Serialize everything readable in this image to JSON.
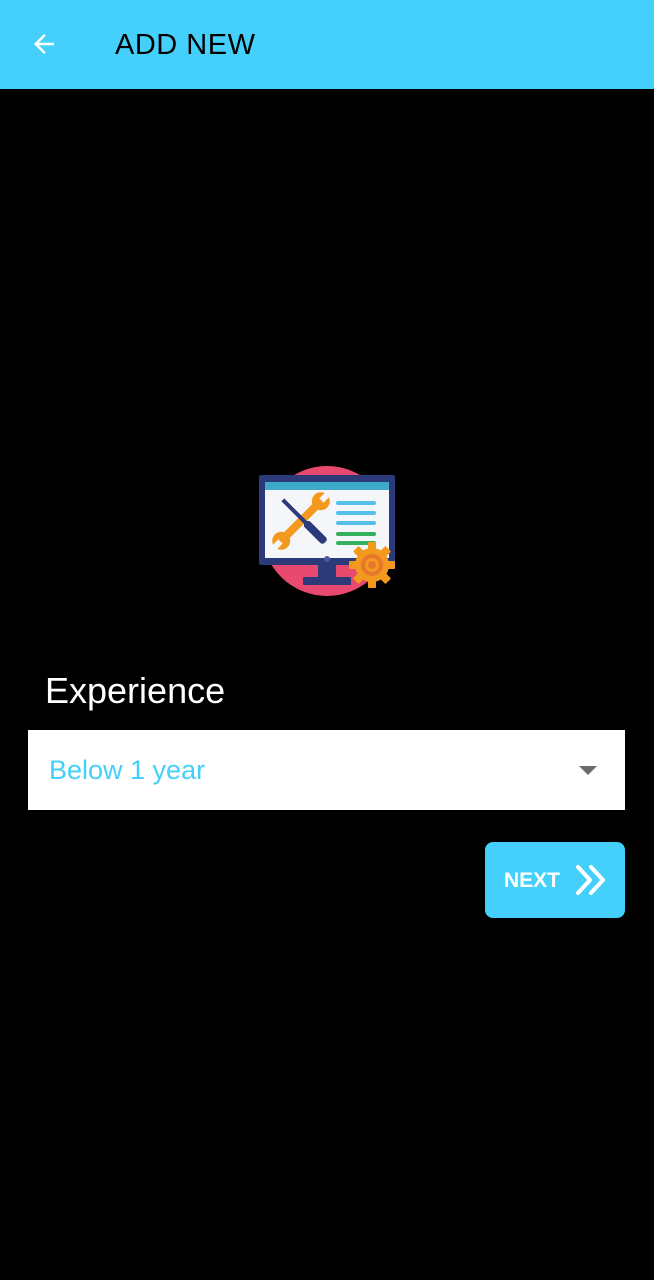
{
  "app_bar": {
    "title": "ADD NEW",
    "back_icon": "arrow-back-icon",
    "color": "#45D0FC"
  },
  "illustration": {
    "icon": "monitor-tools-settings-icon"
  },
  "form": {
    "experience_label": "Experience",
    "experience_select": {
      "value": "Below 1 year",
      "dropdown_icon": "dropdown-arrow-icon"
    }
  },
  "next_button": {
    "label": "NEXT",
    "icon": "double-chevron-right-icon"
  },
  "colors": {
    "accent": "#45D0FC",
    "background": "#000000",
    "select_text": "#45D0FC"
  }
}
